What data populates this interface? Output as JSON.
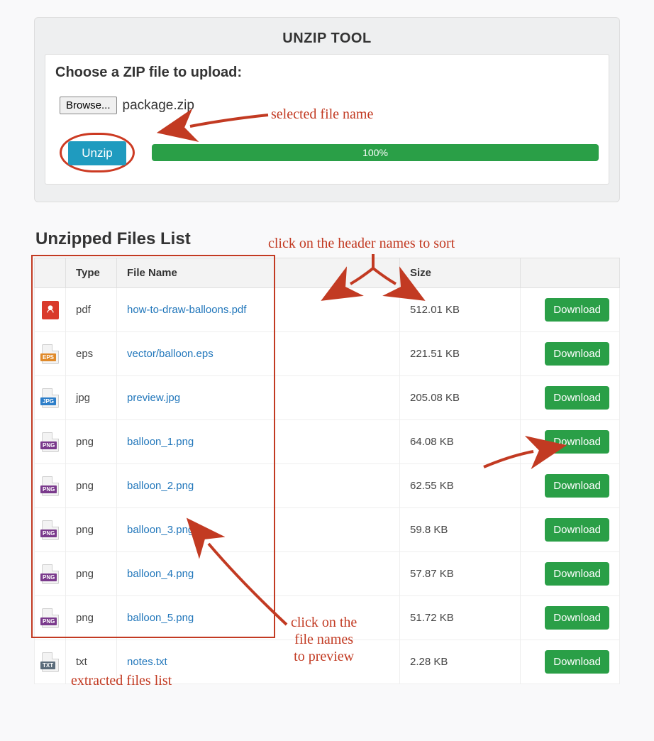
{
  "header": {
    "title": "UNZIP TOOL"
  },
  "form": {
    "choose_label": "Choose a ZIP file to upload:",
    "browse_label": "Browse...",
    "selected_filename": "package.zip",
    "unzip_label": "Unzip",
    "progress_text": "100%"
  },
  "annotations": {
    "selected_file": "selected file name",
    "sort_hint": "click on the header names to sort",
    "preview_hint_l1": "click on the",
    "preview_hint_l2": "file names",
    "preview_hint_l3": "to preview",
    "extracted_list": "extracted files list"
  },
  "list": {
    "title": "Unzipped Files List",
    "columns": {
      "icon": "",
      "type": "Type",
      "name": "File Name",
      "size": "Size",
      "action": ""
    },
    "download_label": "Download",
    "rows": [
      {
        "icon": "pdf",
        "type": "pdf",
        "name": "how-to-draw-balloons.pdf",
        "size": "512.01 KB"
      },
      {
        "icon": "eps",
        "type": "eps",
        "name": "vector/balloon.eps",
        "size": "221.51 KB"
      },
      {
        "icon": "jpg",
        "type": "jpg",
        "name": "preview.jpg",
        "size": "205.08 KB"
      },
      {
        "icon": "png",
        "type": "png",
        "name": "balloon_1.png",
        "size": "64.08 KB"
      },
      {
        "icon": "png",
        "type": "png",
        "name": "balloon_2.png",
        "size": "62.55 KB"
      },
      {
        "icon": "png",
        "type": "png",
        "name": "balloon_3.png",
        "size": "59.8 KB"
      },
      {
        "icon": "png",
        "type": "png",
        "name": "balloon_4.png",
        "size": "57.87 KB"
      },
      {
        "icon": "png",
        "type": "png",
        "name": "balloon_5.png",
        "size": "51.72 KB"
      },
      {
        "icon": "txt",
        "type": "txt",
        "name": "notes.txt",
        "size": "2.28 KB"
      }
    ]
  }
}
